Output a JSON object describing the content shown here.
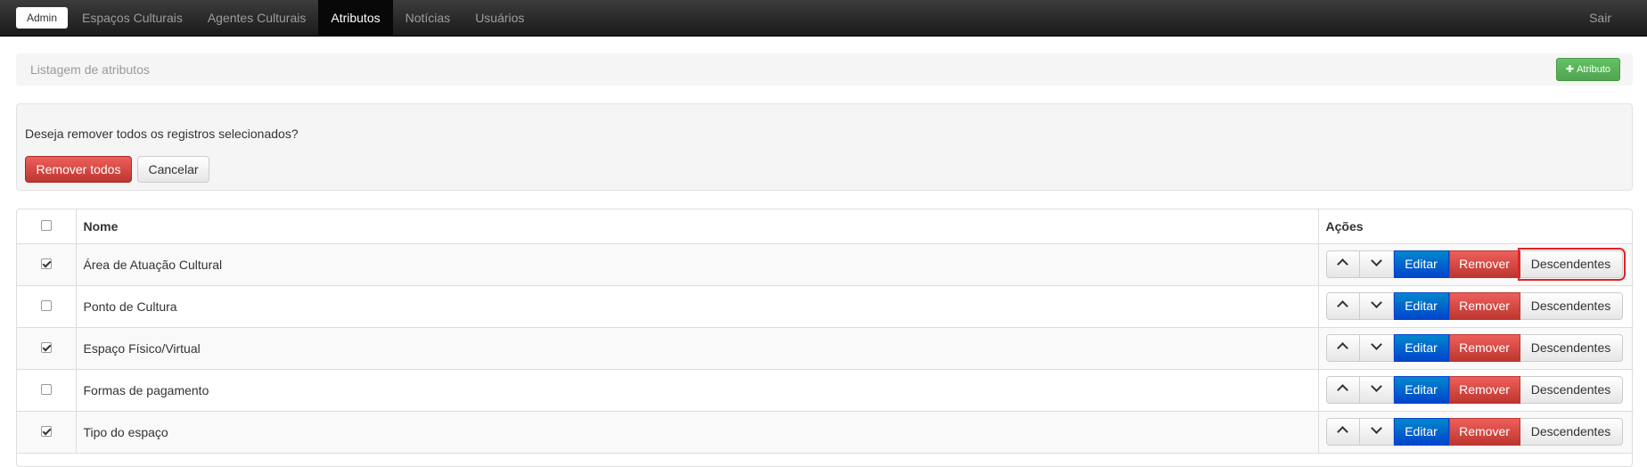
{
  "nav": {
    "brand": "Admin",
    "items": [
      {
        "label": "Espaços Culturais",
        "active": false
      },
      {
        "label": "Agentes Culturais",
        "active": false
      },
      {
        "label": "Atributos",
        "active": true
      },
      {
        "label": "Notícias",
        "active": false
      },
      {
        "label": "Usuários",
        "active": false
      }
    ],
    "logout": "Sair"
  },
  "header": {
    "title": "Listagem de atributos",
    "add_button": "Atributo"
  },
  "confirm": {
    "question": "Deseja remover todos os registros selecionados?",
    "remove_all": "Remover todos",
    "cancel": "Cancelar"
  },
  "table": {
    "columns": [
      "",
      "Nome",
      "Ações"
    ],
    "actions": {
      "edit": "Editar",
      "remove": "Remover",
      "descendants": "Descendentes"
    },
    "rows": [
      {
        "checked": true,
        "name": "Área de Atuação Cultural"
      },
      {
        "checked": false,
        "name": "Ponto de Cultura"
      },
      {
        "checked": true,
        "name": "Espaço Físico/Virtual"
      },
      {
        "checked": false,
        "name": "Formas de pagamento"
      },
      {
        "checked": true,
        "name": "Tipo do espaço"
      }
    ]
  },
  "colors": {
    "navbar": "#222222",
    "success": "#5cb85c",
    "primary": "#0055cc",
    "danger": "#d9534f",
    "highlight": "#e02424"
  },
  "icons": {
    "add": "plus-icon",
    "move_up": "chevron-up-icon",
    "move_down": "chevron-down-icon"
  }
}
